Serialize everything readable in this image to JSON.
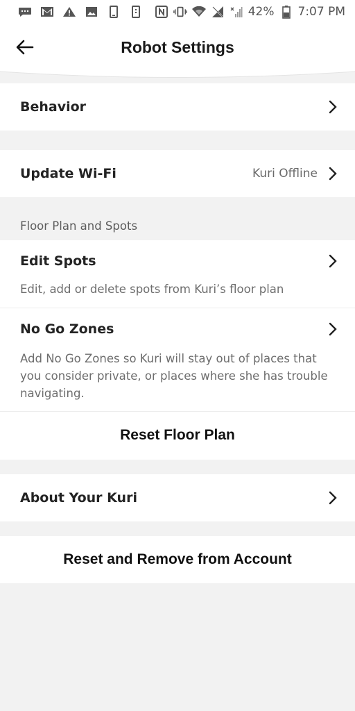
{
  "status_bar": {
    "battery": "42%",
    "time": "7:07 PM",
    "left_icons": [
      "message-icon",
      "gmail-icon",
      "warning-icon",
      "photo-icon",
      "phone-outline-icon",
      "sim-icon"
    ],
    "right_icons": [
      "nfc-icon",
      "vibrate-icon",
      "wifi-icon",
      "no-signal-icon",
      "signal-x-icon",
      "battery-icon"
    ]
  },
  "header": {
    "title": "Robot Settings",
    "back_icon": "arrow-left-icon"
  },
  "items": {
    "behavior": {
      "label": "Behavior"
    },
    "update_wifi": {
      "label": "Update Wi-Fi",
      "value": "Kuri Offline"
    },
    "floor_plan_section": "Floor Plan and Spots",
    "edit_spots": {
      "label": "Edit Spots",
      "desc": "Edit, add or delete spots from Kuri’s floor plan"
    },
    "no_go_zones": {
      "label": "No Go Zones",
      "desc": [
        "Add No Go Zones so Kuri will stay out of places that",
        "you consider private, or places where she has trouble",
        "navigating."
      ]
    },
    "reset_floor_plan": "Reset Floor Plan",
    "about": {
      "label": "About Your Kuri"
    },
    "reset_remove": "Reset and Remove from Account"
  },
  "colors": {
    "background": "#f2f2f2",
    "card": "#ffffff",
    "text_primary": "#232323",
    "text_secondary": "#6d6d6d"
  }
}
